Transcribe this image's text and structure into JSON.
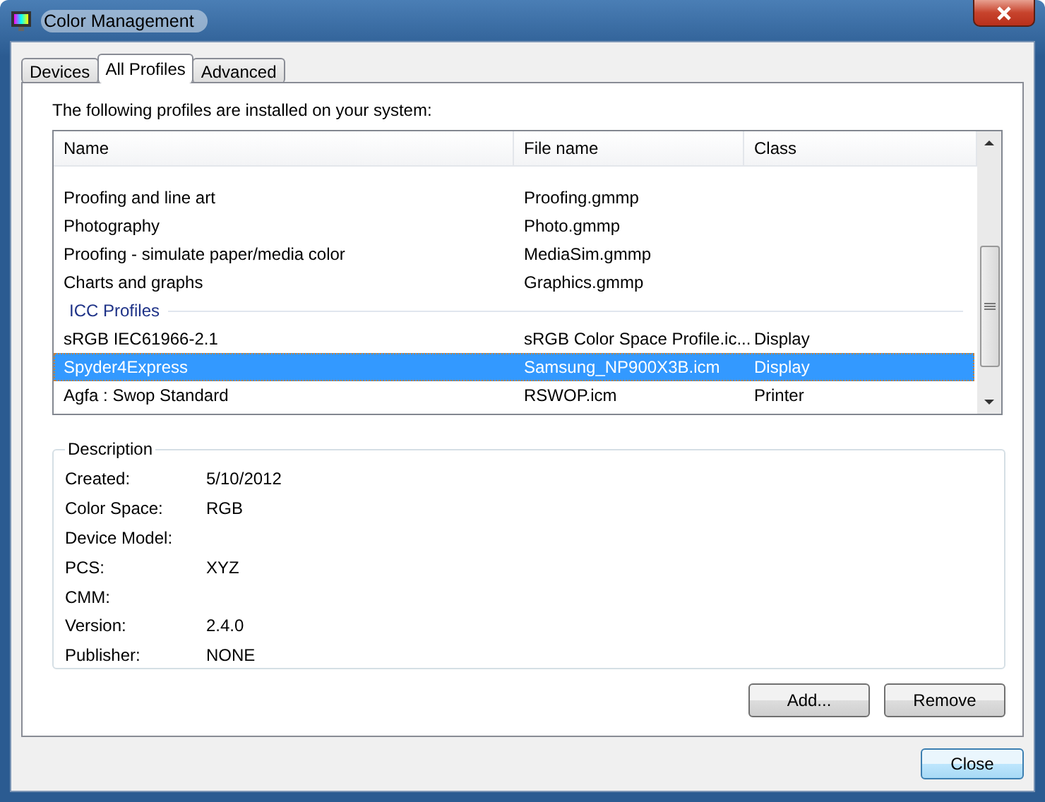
{
  "window": {
    "title": "Color Management"
  },
  "tabs": [
    {
      "label": "Devices",
      "selected": false
    },
    {
      "label": "All Profiles",
      "selected": true
    },
    {
      "label": "Advanced",
      "selected": false
    }
  ],
  "intro": "The following profiles are installed on your system:",
  "table": {
    "columns": [
      "Name",
      "File name",
      "Class"
    ],
    "rows": [
      {
        "kind": "profile",
        "name": "Proofing and line art",
        "file": "Proofing.gmmp",
        "selected": false
      },
      {
        "kind": "profile",
        "name": "Photography",
        "file": "Photo.gmmp",
        "selected": false
      },
      {
        "kind": "profile",
        "name": "Proofing - simulate paper/media color",
        "file": "MediaSim.gmmp",
        "selected": false
      },
      {
        "kind": "profile",
        "name": "Charts and graphs",
        "file": "Graphics.gmmp",
        "selected": false
      },
      {
        "kind": "group",
        "name": "ICC Profiles"
      },
      {
        "kind": "profile",
        "name": "sRGB IEC61966-2.1",
        "file": "sRGB Color Space Profile.ic...",
        "class": "Display",
        "selected": false
      },
      {
        "kind": "profile",
        "name": "Spyder4Express",
        "file": "Samsung_NP900X3B.icm",
        "class": "Display",
        "selected": true
      },
      {
        "kind": "profile",
        "name": "Agfa : Swop Standard",
        "file": "RSWOP.icm",
        "class": "Printer",
        "selected": false
      }
    ]
  },
  "description": {
    "title": "Description",
    "fields": [
      {
        "label": "Created:",
        "value": "5/10/2012"
      },
      {
        "label": "Color Space:",
        "value": "RGB"
      },
      {
        "label": "Device Model:"
      },
      {
        "label": "PCS:",
        "value": "XYZ"
      },
      {
        "label": "CMM:"
      },
      {
        "label": "Version:",
        "value": "2.4.0"
      },
      {
        "label": "Publisher:",
        "value": "NONE"
      }
    ]
  },
  "buttons": [
    "Add...",
    "Remove"
  ],
  "close_button": "Close"
}
